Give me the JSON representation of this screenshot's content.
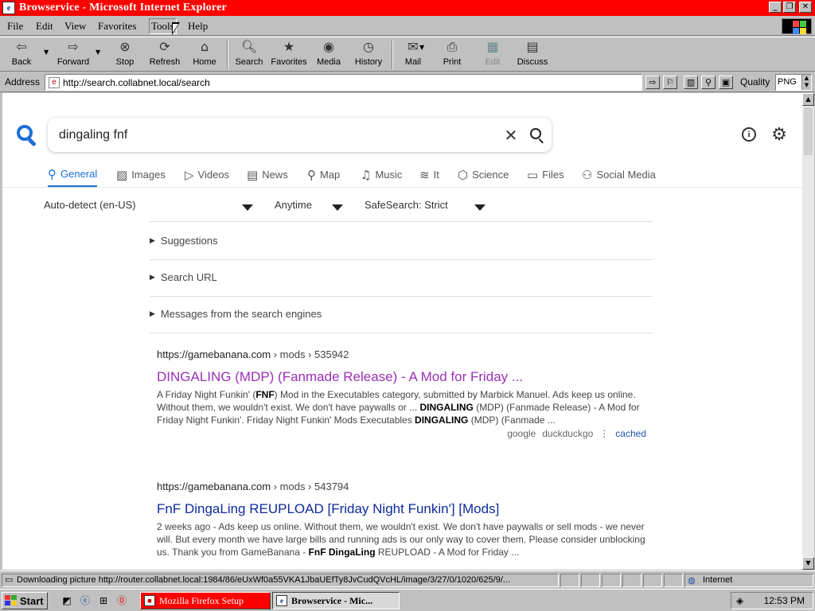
{
  "window": {
    "title": "Browservice - Microsoft Internet Explorer",
    "icon": "ie-page-icon"
  },
  "menubar": {
    "items": [
      "File",
      "Edit",
      "View",
      "Favorites",
      "Tools",
      "Help"
    ],
    "active": "Tools"
  },
  "toolbar": {
    "buttons": [
      {
        "label": "Back",
        "icon": "back-arrow-icon"
      },
      {
        "label": "Forward",
        "icon": "forward-arrow-icon"
      },
      {
        "label": "Stop",
        "icon": "stop-icon"
      },
      {
        "label": "Refresh",
        "icon": "refresh-icon"
      },
      {
        "label": "Home",
        "icon": "home-icon"
      },
      {
        "label": "Search",
        "icon": "search-icon"
      },
      {
        "label": "Favorites",
        "icon": "favorites-icon"
      },
      {
        "label": "Media",
        "icon": "media-icon"
      },
      {
        "label": "History",
        "icon": "history-icon"
      },
      {
        "label": "Mail",
        "icon": "mail-icon"
      },
      {
        "label": "Print",
        "icon": "print-icon"
      },
      {
        "label": "Edit",
        "icon": "edit-icon",
        "disabled": true
      },
      {
        "label": "Discuss",
        "icon": "discuss-icon"
      }
    ]
  },
  "address": {
    "label": "Address",
    "url": "http://search.collabnet.local/search",
    "quality_label": "Quality",
    "quality_value": "PNG"
  },
  "page": {
    "query": "dingaling fnf",
    "tabs": [
      {
        "label": "General",
        "icon": "search-icon",
        "active": true
      },
      {
        "label": "Images",
        "icon": "image-icon"
      },
      {
        "label": "Videos",
        "icon": "play-icon"
      },
      {
        "label": "News",
        "icon": "newspaper-icon"
      },
      {
        "label": "Map",
        "icon": "map-pin-icon"
      },
      {
        "label": "Music",
        "icon": "music-note-icon"
      },
      {
        "label": "It",
        "icon": "layers-icon"
      },
      {
        "label": "Science",
        "icon": "cube-icon"
      },
      {
        "label": "Files",
        "icon": "files-icon"
      },
      {
        "label": "Social Media",
        "icon": "people-icon"
      }
    ],
    "filters": {
      "language": "Auto-detect (en-US)",
      "time": "Anytime",
      "safesearch": "SafeSearch: Strict"
    },
    "collapsibles": [
      "Suggestions",
      "Search URL",
      "Messages from the search engines"
    ],
    "results": [
      {
        "domain": "https://gamebanana.com",
        "path": "› mods › 535942",
        "title": "DINGALING (MDP) (Fanmade Release) - A Mod for Friday ...",
        "visited": true,
        "desc": [
          {
            "t": "A Friday Night Funkin' (",
            "b": false
          },
          {
            "t": "FNF",
            "b": true
          },
          {
            "t": ") Mod in the Executables category, submitted by Marbick Manuel. Ads keep us online. Without them, we wouldn't exist. We don't have paywalls or ... ",
            "b": false
          },
          {
            "t": "DINGALING",
            "b": true
          },
          {
            "t": " (MDP) (Fanmade Release) - A Mod for Friday Night Funkin'. Friday Night Funkin' Mods Executables ",
            "b": false
          },
          {
            "t": "DINGALING",
            "b": true
          },
          {
            "t": " (MDP) (Fanmade ...",
            "b": false
          }
        ],
        "engines": [
          "google",
          "duckduckgo"
        ],
        "cached": "cached"
      },
      {
        "domain": "https://gamebanana.com",
        "path": "› mods › 543794",
        "title": "FnF DingaLing REUPLOAD [Friday Night Funkin'] [Mods]",
        "visited": false,
        "desc": [
          {
            "t": "2 weeks ago - Ads keep us online. Without them, we wouldn't exist. We don't have paywalls or sell mods - we never will. But every month we have large bills and running ads is our only way to cover them. Please consider unblocking us. Thank you from GameBanana - ",
            "b": false
          },
          {
            "t": "FnF DingaLing",
            "b": true
          },
          {
            "t": " REUPLOAD - A Mod for Friday ...",
            "b": false
          }
        ]
      }
    ]
  },
  "status": {
    "text": "Downloading picture http://router.collabnet.local:1984/86/eUxWf0a55VKA1JbaUEfTy8JvCudQVcHL/image/3/27/0/1020/625/9/...",
    "zone": "Internet"
  },
  "taskbar": {
    "start": "Start",
    "tasks": [
      "Mozilla Firefox Setup",
      "Browservice - Mic..."
    ],
    "clock": "12:53 PM"
  }
}
